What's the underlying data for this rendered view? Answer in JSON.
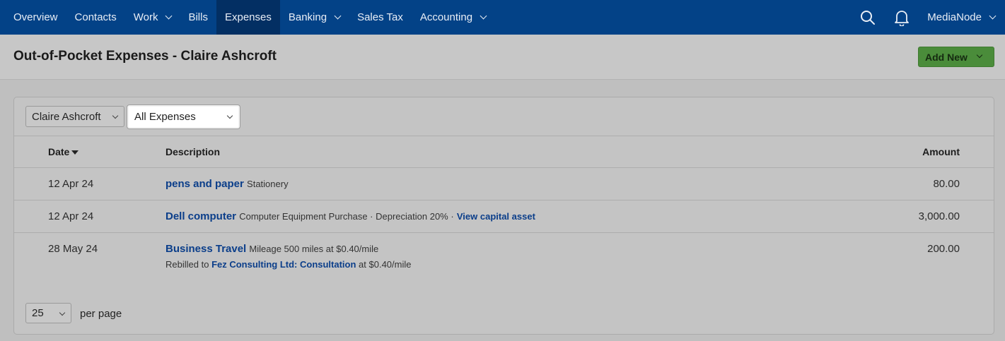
{
  "nav": {
    "items": [
      {
        "label": "Overview",
        "dropdown": false,
        "active": false
      },
      {
        "label": "Contacts",
        "dropdown": false,
        "active": false
      },
      {
        "label": "Work",
        "dropdown": true,
        "active": false
      },
      {
        "label": "Bills",
        "dropdown": false,
        "active": false
      },
      {
        "label": "Expenses",
        "dropdown": false,
        "active": true
      },
      {
        "label": "Banking",
        "dropdown": true,
        "active": false
      },
      {
        "label": "Sales Tax",
        "dropdown": false,
        "active": false
      },
      {
        "label": "Accounting",
        "dropdown": true,
        "active": false
      }
    ],
    "search_icon": "search-icon",
    "notifications_icon": "bell-icon",
    "company": "MediaNode"
  },
  "page": {
    "title": "Out-of-Pocket Expenses - Claire Ashcroft",
    "add_new_label": "Add New"
  },
  "filters": {
    "person": "Claire Ashcroft",
    "type": "All Expenses"
  },
  "table": {
    "headers": {
      "date": "Date",
      "description": "Description",
      "amount": "Amount"
    },
    "sort": {
      "column": "Date",
      "direction": "descending"
    },
    "rows": [
      {
        "date": "12 Apr 24",
        "title": "pens and paper",
        "detail": "Stationery",
        "amount": "80.00"
      },
      {
        "date": "12 Apr 24",
        "title": "Dell computer",
        "detail": "Computer Equipment Purchase · Depreciation 20% ·",
        "link": "View capital asset",
        "amount": "3,000.00"
      },
      {
        "date": "28 May 24",
        "title": "Business Travel",
        "detail": "Mileage 500 miles at $0.40/mile",
        "rebill_prefix": "Rebilled to",
        "rebill_link": "Fez Consulting Ltd: Consultation",
        "rebill_suffix": "at $0.40/mile",
        "amount": "200.00"
      }
    ]
  },
  "pagination": {
    "per_page_value": "25",
    "per_page_label": "per page"
  },
  "colors": {
    "nav_bg": "#034287",
    "nav_active_bg": "#032f63",
    "link": "#0b3e8a",
    "add_button": "#4a8c3a"
  }
}
